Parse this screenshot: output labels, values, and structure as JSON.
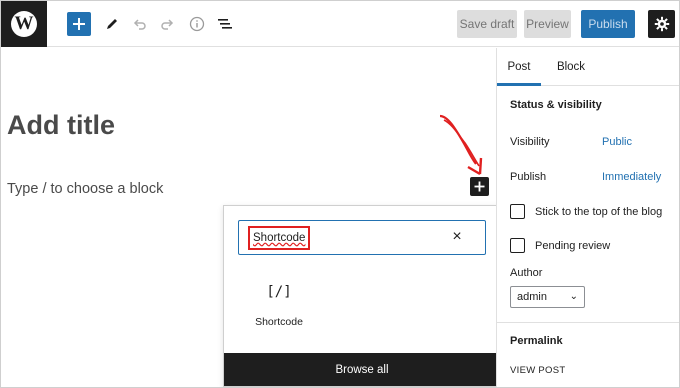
{
  "toolbar": {
    "logo_letter": "W",
    "save_draft": "Save draft",
    "preview": "Preview",
    "publish": "Publish"
  },
  "editor": {
    "title_placeholder": "Add title",
    "block_placeholder": "Type / to choose a block"
  },
  "inserter": {
    "search_value": "Shortcode",
    "clear": "×",
    "result_icon": "[/]",
    "result_label": "Shortcode",
    "browse_all": "Browse all"
  },
  "sidebar": {
    "tabs": [
      "Post",
      "Block"
    ],
    "status_title": "Status & visibility",
    "visibility_label": "Visibility",
    "visibility_value": "Public",
    "publish_label": "Publish",
    "publish_value": "Immediately",
    "sticky_label": "Stick to the top of the blog",
    "pending_label": "Pending review",
    "author_label": "Author",
    "author_value": "admin",
    "permalink_title": "Permalink",
    "view_post": "VIEW POST"
  },
  "colors": {
    "accent": "#2271b1",
    "dark": "#1e1e1e",
    "highlight": "#e02020"
  },
  "icons": [
    "wordpress-logo-icon",
    "plus-icon",
    "pen-icon",
    "undo-icon",
    "redo-icon",
    "info-icon",
    "list-view-icon",
    "gear-icon",
    "close-icon",
    "shortcode-icon",
    "chevron-down-icon",
    "arrow-annotation-icon"
  ]
}
